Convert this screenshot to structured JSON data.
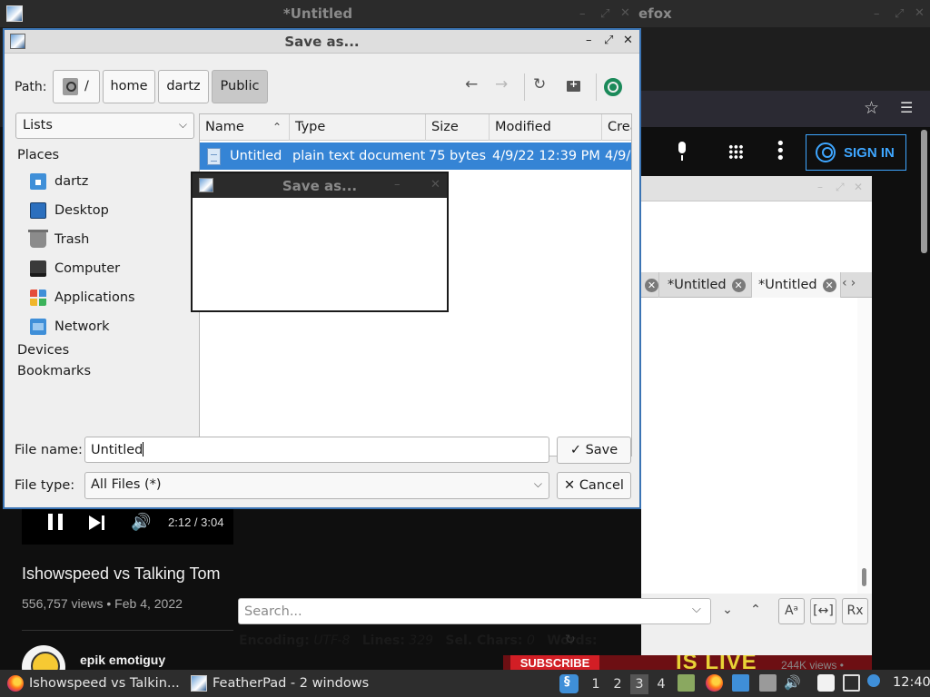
{
  "background_window": {
    "title": "*Untitled",
    "title_right_fragment": "efox"
  },
  "firefox": {
    "bookmark_icon": "star-icon",
    "menu_icon": "hamburger-menu-icon"
  },
  "youtube": {
    "sign_in_label": "SIGN IN",
    "player_time": "2:12 / 3:04",
    "video_title": "Ishowspeed vs Talking Tom",
    "video_meta": "556,757 views • Feb 4, 2022",
    "channel_name": "epik emotiguy",
    "thumbnail_subscribe": "SUBSCRIBE",
    "thumbnail_live": "IS LIVE",
    "thumbnail_views": "244K views •",
    "accent_color": "#3ea6ff"
  },
  "featherpad": {
    "tabs": [
      {
        "label": "*Untitled"
      },
      {
        "label": "*Untitled"
      }
    ],
    "search_placeholder": "Search...",
    "status": {
      "encoding_label": "Encoding:",
      "encoding_value": "UTF-8",
      "lines_label": "Lines:",
      "lines_value": "329",
      "selchars_label": "Sel. Chars:",
      "selchars_value": "0",
      "words_label": "Words:"
    }
  },
  "dialog": {
    "title": "Save as...",
    "path_label": "Path:",
    "breadcrumbs": [
      "/",
      "home",
      "dartz",
      "Public"
    ],
    "sidebar_mode": "Lists",
    "places_heading": "Places",
    "places": [
      {
        "label": "dartz",
        "icon": "home-folder-icon"
      },
      {
        "label": "Desktop",
        "icon": "desktop-icon"
      },
      {
        "label": "Trash",
        "icon": "trash-icon"
      },
      {
        "label": "Computer",
        "icon": "computer-icon"
      },
      {
        "label": "Applications",
        "icon": "applications-icon"
      },
      {
        "label": "Network",
        "icon": "network-folder-icon"
      }
    ],
    "devices_heading": "Devices",
    "bookmarks_heading": "Bookmarks",
    "columns": [
      "Name",
      "Type",
      "Size",
      "Modified",
      "Crea"
    ],
    "files": [
      {
        "name": "Untitled",
        "type": "plain text document",
        "size": "75 bytes",
        "modified": "4/9/22 12:39 PM",
        "created": "4/9/"
      }
    ],
    "filename_label": "File name:",
    "filename_value": "Untitled",
    "filetype_label": "File type:",
    "filetype_value": "All Files (*)",
    "save_label": "Save",
    "cancel_label": "Cancel",
    "selection_color": "#3584d5",
    "border_color": "#3b74b4"
  },
  "ghost_dialog": {
    "title": "Save as..."
  },
  "taskbar": {
    "tasks": [
      {
        "label": "Ishowspeed vs Talkin...",
        "icon": "firefox-icon"
      },
      {
        "label": "FeatherPad - 2 windows",
        "icon": "featherpad-icon"
      }
    ],
    "workspaces": [
      "1",
      "2",
      "3",
      "4"
    ],
    "active_workspace": "3",
    "clock": "12:40"
  }
}
